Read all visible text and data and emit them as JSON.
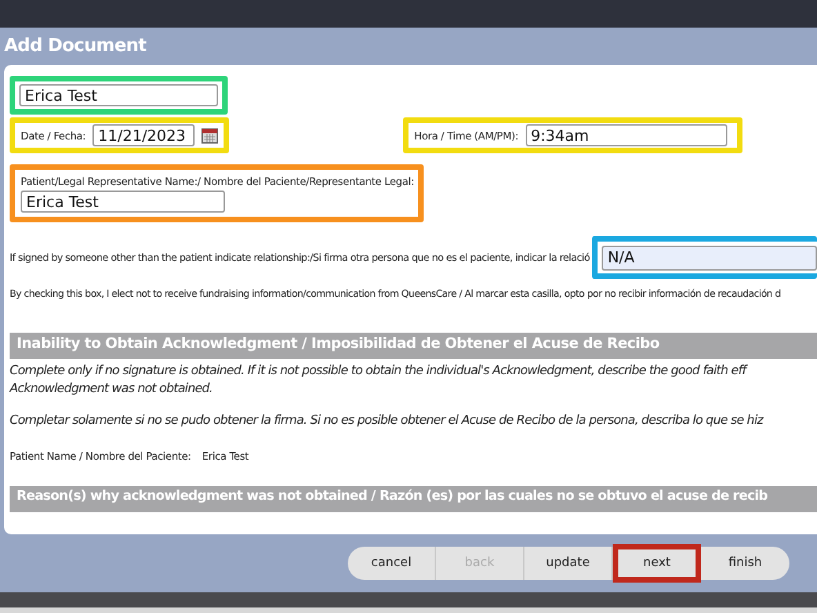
{
  "window": {
    "title": "Add Document"
  },
  "name_field": {
    "value": "Erica Test",
    "color": "#2ed47a"
  },
  "date": {
    "label": "Date / Fecha:",
    "value": "11/21/2023",
    "color": "#f2dc10"
  },
  "time": {
    "label": "Hora / Time (AM/PM):",
    "value": "9:34am",
    "color": "#f2dc10"
  },
  "representative": {
    "label": "Patient/Legal Representative Name:/ Nombre del Paciente/Representante Legal:",
    "value": "Erica Test",
    "color": "#f7901e"
  },
  "relationship": {
    "label": "If signed by someone other than the patient indicate relationship:/Si firma otra persona que no es el paciente, indicar la relació",
    "value": "N/A",
    "color": "#1ba8e0"
  },
  "fundraising_notice": "By checking this box, I elect not to receive fundraising information/communication from QueensCare / Al marcar esta casilla, opto por no recibir información de recaudación d",
  "section": {
    "heading": "Inability to Obtain Acknowledgment / Imposibilidad de Obtener el Acuse de Recibo",
    "instructions_en": [
      "Complete only if no signature is obtained. If it is not possible to obtain the individual's Acknowledgment, describe the good faith eff",
      "Acknowledgment was not obtained."
    ],
    "instructions_es": "Completar solamente si no se pudo obtener la firma. Si no es posible obtener el Acuse de Recibo de la persona, describa lo que se hiz",
    "patient_label": "Patient Name / Nombre del Paciente:",
    "patient_value": "Erica  Test"
  },
  "section2": {
    "heading": "Reason(s) why acknowledgment was not obtained / Razón (es) por las cuales no se obtuvo el acuse de recib"
  },
  "buttons": [
    {
      "label": "cancel",
      "disabled": false
    },
    {
      "label": "back",
      "disabled": true
    },
    {
      "label": "update",
      "disabled": false
    },
    {
      "label": "next",
      "disabled": false,
      "color": "#c0281c"
    },
    {
      "label": "finish",
      "disabled": false
    }
  ]
}
